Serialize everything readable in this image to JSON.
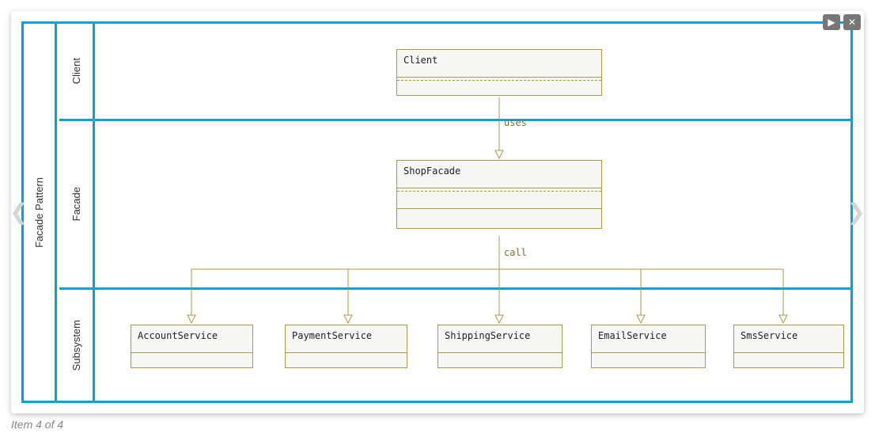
{
  "caption": "Item 4 of 4",
  "title": "Facade Pattern",
  "lanes": {
    "client": "Client",
    "facade": "Facade",
    "subsystem": "Subsystem"
  },
  "boxes": {
    "client": "Client",
    "facade": "ShopFacade",
    "account": "AccountService",
    "payment": "PaymentService",
    "shipping": "ShippingService",
    "email": "EmailService",
    "sms": "SmsService"
  },
  "edges": {
    "uses": "uses",
    "call": "call"
  },
  "icons": {
    "play": "▶",
    "close": "✕",
    "prev": "❮",
    "next": "❯"
  }
}
